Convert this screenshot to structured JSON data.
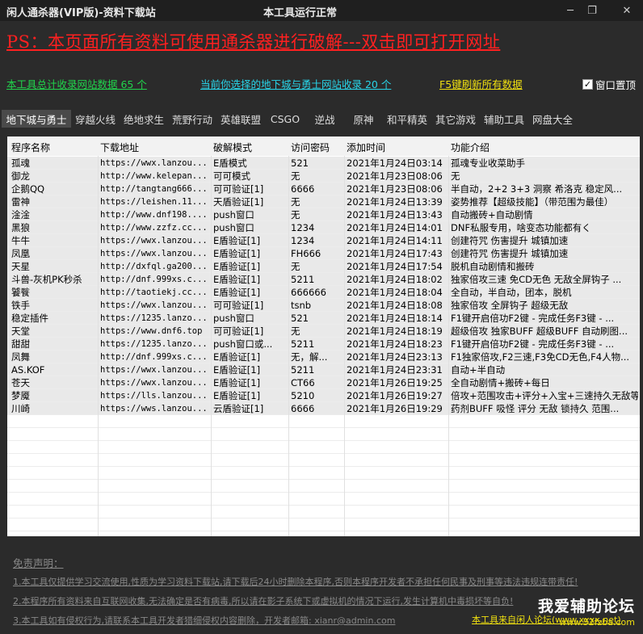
{
  "window": {
    "app_title": "闲人通杀器(VIP版)-资料下载站",
    "status_title": "本工具运行正常",
    "minimize_label": "─",
    "restore_label": "❐",
    "close_label": "✕"
  },
  "banner": {
    "ps_text": "PS：本页面所有资料可使用通杀器进行破解---双击即可打开网址"
  },
  "stats": {
    "total_text": "本工具总计收录网站数据 65 个",
    "selected_text": "当前你选择的地下城与勇士网站收录 20 个",
    "refresh_text": "F5键刷新所有数据"
  },
  "topmost": {
    "label": "窗口置顶",
    "checked": true
  },
  "tabs": [
    "地下城与勇士",
    "穿越火线",
    "绝地求生",
    "荒野行动",
    "英雄联盟",
    "CSGO",
    "逆战",
    "原神",
    "和平精英",
    "其它游戏",
    "辅助工具",
    "网盘大全"
  ],
  "active_tab": 0,
  "table": {
    "columns": [
      "程序名称",
      "下载地址",
      "破解模式",
      "访问密码",
      "添加时间",
      "功能介绍"
    ],
    "rows": [
      [
        "孤魂",
        "https://wwx.lanzou...",
        "E盾模式",
        "521",
        "2021年1月24日03:14",
        "孤魂专业收菜助手"
      ],
      [
        "御龙",
        "http://www.kelepan...",
        "可可模式",
        "无",
        "2021年1月23日08:06",
        "无"
      ],
      [
        "企鹅QQ",
        "http://tangtang666...",
        "可可验证[1]",
        "6666",
        "2021年1月23日08:06",
        "半自动，2+2 3+3 洞察 希洛克 稳定风..."
      ],
      [
        "雷神",
        "https://leishen.11...",
        "天盾验证[1]",
        "无",
        "2021年1月24日13:39",
        "姿势推荐【超级技能】（带范围为最佳）"
      ],
      [
        "淦淦",
        "http://www.dnf198....",
        "push窗口",
        "无",
        "2021年1月24日13:43",
        "自动搬砖+自动剧情"
      ],
      [
        "黑狼",
        "http://www.zzfz.cc...",
        "push窗口",
        "1234",
        "2021年1月24日14:01",
        "DNF私服专用，啥变态功能都有く"
      ],
      [
        "牛牛",
        "https://wwx.lanzou...",
        "E盾验证[1]",
        "1234",
        "2021年1月24日14:11",
        "创建符咒 伤害提升 城镇加速"
      ],
      [
        "凤凰",
        "https://wwx.lanzou...",
        "E盾验证[1]",
        "FH666",
        "2021年1月24日17:43",
        "创建符咒 伤害提升 城镇加速"
      ],
      [
        "天星",
        "http://dxfql.ga200...",
        "E盾验证[1]",
        "无",
        "2021年1月24日17:54",
        "脱机自动剧情和搬砖"
      ],
      [
        "斗兽-灰机PK秒杀",
        "http://dnf.999xs.c...",
        "E盾验证[1]",
        "5211",
        "2021年1月24日18:02",
        "独家倍攻三速 免CD无色 无敌全屏钩子 ..."
      ],
      [
        "饕餮",
        "http://taotiekj.cc...",
        "E盾验证[1]",
        "666666",
        "2021年1月24日18:04",
        "全自动，半自动，团本，脱机"
      ],
      [
        "铁手",
        "https://wwx.lanzou...",
        "可可验证[1]",
        "tsnb",
        "2021年1月24日18:08",
        "独家倍攻 全屏钩子 超级无敌"
      ],
      [
        "稳定插件",
        "https://1235.lanzo...",
        "push窗口",
        "521",
        "2021年1月24日18:14",
        "F1键开启倍功F2键 - 完成任务F3键 - ..."
      ],
      [
        "天堂",
        "https://www.dnf6.top",
        "可可验证[1]",
        "无",
        "2021年1月24日18:19",
        "超级倍攻 独家BUFF 超级BUFF 自动刷图..."
      ],
      [
        "甜甜",
        "https://1235.lanzo...",
        "push窗口或...",
        "5211",
        "2021年1月24日18:23",
        "F1键开启倍功F2键 - 完成任务F3键 - ..."
      ],
      [
        "凤舞",
        "http://dnf.999xs.c...",
        "E盾验证[1]",
        "无，解...",
        "2021年1月24日23:13",
        "F1独家倍攻,F2三速,F3免CD无色,F4人物..."
      ],
      [
        "AS.KOF",
        "https://wwx.lanzou...",
        "E盾验证[1]",
        "5211",
        "2021年1月24日23:31",
        "自动+半自动"
      ],
      [
        "苍天",
        "https://wwx.lanzou...",
        "E盾验证[1]",
        "CT66",
        "2021年1月26日19:25",
        "全自动剧情+搬砖+每日"
      ],
      [
        "梦魇",
        "https://lls.lanzou...",
        "E盾验证[1]",
        "5210",
        "2021年1月26日19:27",
        "倍攻+范围攻击+评分+入宝+三速持久无敌等"
      ],
      [
        "川崎",
        "https://wws.lanzou...",
        "云盾验证[1]",
        "6666",
        "2021年1月26日19:29",
        "药剂BUFF 吸怪 评分 无敌 锁持久 范围..."
      ]
    ]
  },
  "disclaimer": {
    "title": "免责声明：",
    "lines": [
      "1.本工具仅提供学习交流使用,性质为学习资料下载站,请下载后24小时删除本程序,否则本程序开发者不承担任何民事及刑事等违法违规连带责任!",
      "2.本程序所有资料来自互联网收集,无法确定是否有病毒,所以请在影子系统下或虚拟机的情况下运行,发生计算机中毒损坏等自负!",
      "3.本工具如有侵权行为,请联系本工具开发者猎细侵权内容删除，开发者邮箱: xianr@admin.com"
    ],
    "author_link": "本工具来自闲人论坛(www.xxxx.net)"
  },
  "watermark": {
    "name": "我爱辅助论坛",
    "url": "www.52fzba.com"
  },
  "colors": {
    "background": "#2b2b2b",
    "titlebar": "#1f1f1f",
    "banner_red": "#ff2020",
    "stat_green": "#21d44c",
    "stat_cyan": "#28d4e8",
    "stat_yellow": "#f0e010"
  }
}
